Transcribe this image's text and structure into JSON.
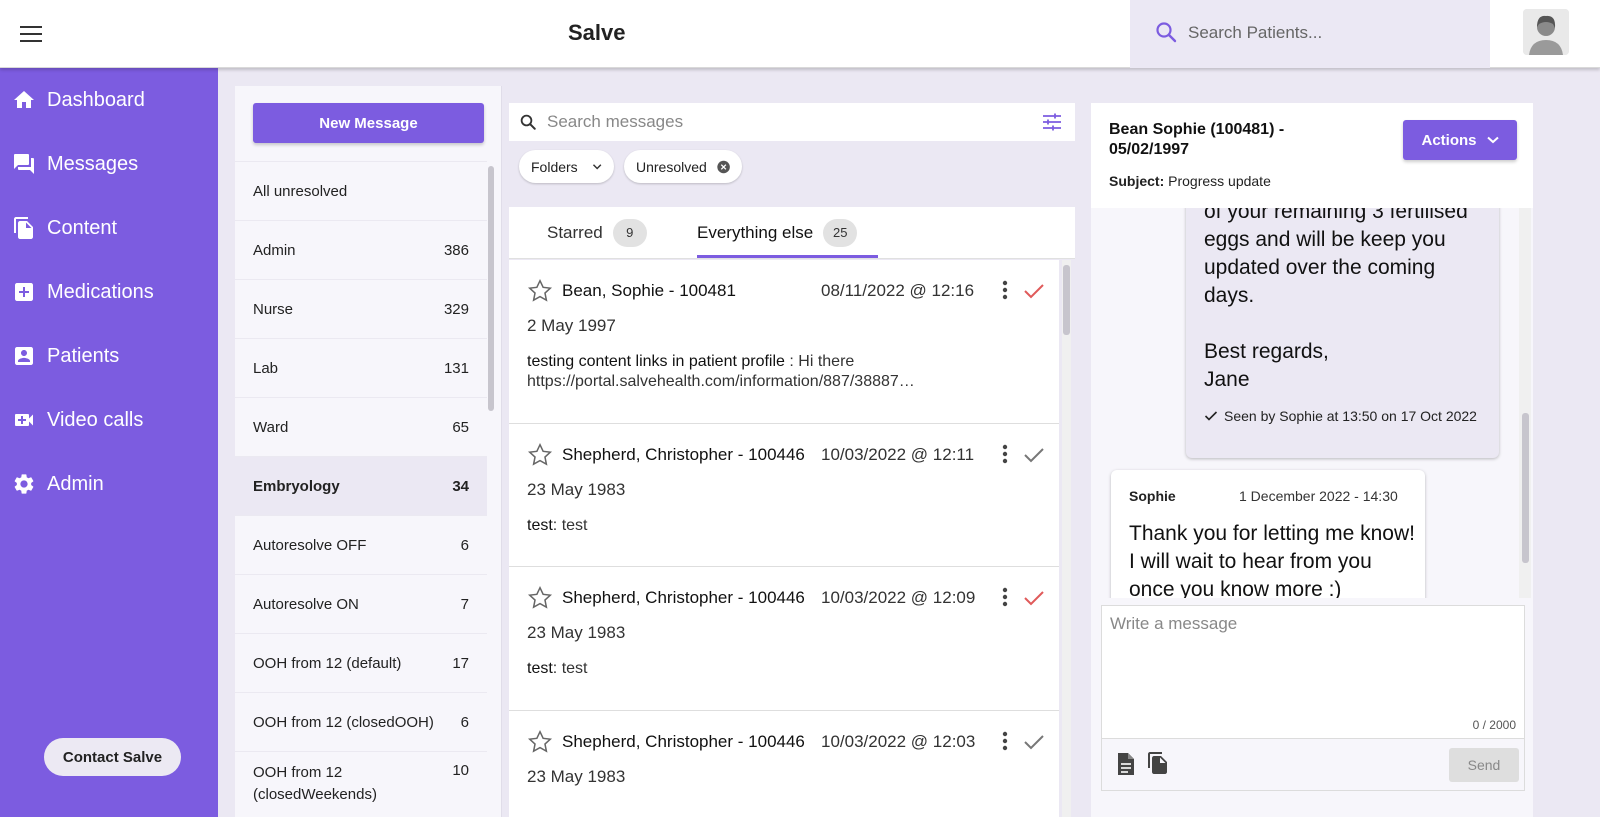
{
  "app": {
    "title": "Salve"
  },
  "search": {
    "placeholder": "Search Patients..."
  },
  "sidebar": {
    "items": [
      {
        "label": "Dashboard",
        "icon": "home-icon"
      },
      {
        "label": "Messages",
        "icon": "forum-icon"
      },
      {
        "label": "Content",
        "icon": "file-copy-icon"
      },
      {
        "label": "Medications",
        "icon": "medical-plus-icon"
      },
      {
        "label": "Patients",
        "icon": "person-badge-icon"
      },
      {
        "label": "Video calls",
        "icon": "video-camera-icon"
      },
      {
        "label": "Admin",
        "icon": "gear-icon"
      }
    ],
    "contact_label": "Contact Salve"
  },
  "folders": {
    "new_message_label": "New Message",
    "items": [
      {
        "label": "All unresolved",
        "count": ""
      },
      {
        "label": "Admin",
        "count": "386"
      },
      {
        "label": "Nurse",
        "count": "329"
      },
      {
        "label": "Lab",
        "count": "131"
      },
      {
        "label": "Ward",
        "count": "65"
      },
      {
        "label": "Embryology",
        "count": "34",
        "active": true
      },
      {
        "label": "Autoresolve OFF",
        "count": "6"
      },
      {
        "label": "Autoresolve ON",
        "count": "7"
      },
      {
        "label": "OOH from 12 (default)",
        "count": "17"
      },
      {
        "label": "OOH from 12 (closedOOH)",
        "count": "6"
      },
      {
        "label": "OOH from 12 (closedWeekends)",
        "count": "10"
      }
    ]
  },
  "messages": {
    "search_placeholder": "Search messages",
    "filters": {
      "folders_label": "Folders",
      "unresolved_label": "Unresolved"
    },
    "tabs": [
      {
        "label": "Starred",
        "count": "9"
      },
      {
        "label": "Everything else",
        "count": "25",
        "active": true
      }
    ],
    "list": [
      {
        "name": "Bean, Sophie - 100481",
        "date": "08/11/2022 @ 12:16",
        "dob": "2 May 1997",
        "subject": "testing content links in patient profile",
        "preview": "Hi there https://portal.salvehealth.com/information/887/38887…",
        "resolved": true
      },
      {
        "name": "Shepherd, Christopher - 100446",
        "date": "10/03/2022 @ 12:11",
        "dob": "23 May 1983",
        "subject": "test",
        "preview": "test",
        "resolved": false
      },
      {
        "name": "Shepherd, Christopher - 100446",
        "date": "10/03/2022 @ 12:09",
        "dob": "23 May 1983",
        "subject": "test",
        "preview": "test",
        "resolved": true
      },
      {
        "name": "Shepherd, Christopher - 100446",
        "date": "10/03/2022 @ 12:03",
        "dob": "23 May 1983",
        "subject": "",
        "preview": "",
        "resolved": false
      }
    ]
  },
  "conversation": {
    "patient_title": "Bean Sophie (100481) - 05/02/1997",
    "subject_label": "Subject:",
    "subject": "Progress update",
    "actions_label": "Actions",
    "outgoing": {
      "body": "of your remaining 3 fertilised eggs and will be keep you updated over the coming days.\n\nBest regards,\nJane",
      "seen": "Seen by Sophie at 13:50 on 17 Oct 2022"
    },
    "incoming": {
      "from": "Sophie",
      "when": "1 December 2022 - 14:30",
      "body": "Thank you for letting me know! I will wait to hear from you once you know more :)"
    },
    "composer": {
      "placeholder": "Write a message",
      "counter": "0 / 2000",
      "send_label": "Send"
    }
  },
  "colors": {
    "accent": "#7c5ce0",
    "resolved_check": "#e05a5a",
    "unresolved_check": "#777777"
  }
}
